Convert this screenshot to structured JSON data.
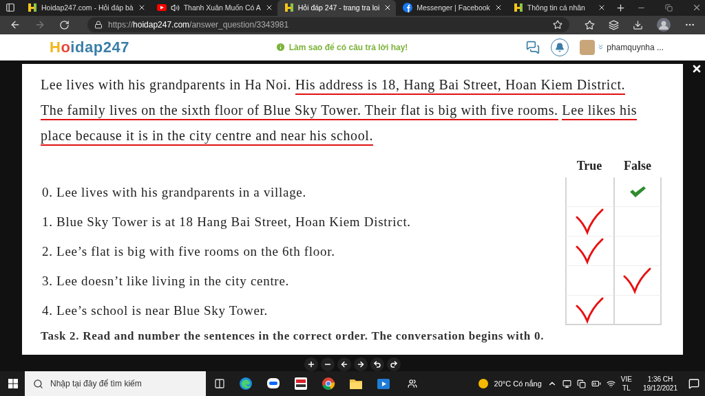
{
  "browser": {
    "tabs": [
      {
        "title": "Hoidap247.com - Hỏi đáp bà",
        "kind": "hoidap",
        "audio": false,
        "selected": false
      },
      {
        "title": "Thanh Xuân Muốn Có A",
        "kind": "video",
        "audio": true,
        "selected": false
      },
      {
        "title": "Hỏi đáp 247 - trang tra loi",
        "kind": "hoidap",
        "audio": false,
        "selected": true
      },
      {
        "title": "Messenger | Facebook",
        "kind": "social",
        "audio": false,
        "selected": false
      },
      {
        "title": "Thông tin cá nhân",
        "kind": "hoidap",
        "audio": false,
        "selected": false
      }
    ],
    "address": {
      "scheme": "https://",
      "domain": "hoidap247.com",
      "path": "/answer_question/3343981"
    }
  },
  "site_header": {
    "logo": "Hoidap247",
    "tip": "Làm sao để có câu trả lời hay!",
    "username": "phamquynha ..."
  },
  "viewer": {
    "document": {
      "paragraph": [
        {
          "text": "Lee lives with his grandparents in Ha Noi.",
          "underlined": false
        },
        {
          "text": "His address is 18, Hang Bai Street, Hoan Kiem District. The family lives on the sixth floor of Blue Sky Tower. Their flat is big with five rooms.",
          "underlined": true
        },
        {
          "text": "Lee likes his place because it is in the city centre and near his school.",
          "underlined": true
        }
      ],
      "columns": [
        "True",
        "False"
      ],
      "statements": [
        {
          "text": "0. Lee lives with his grandparents in a village.",
          "marked_true": false,
          "kind": "example"
        },
        {
          "text": "1. Blue Sky Tower is at 18 Hang Bai Street, Hoan Kiem District.",
          "marked_true": true,
          "kind": "handwritten"
        },
        {
          "text": "2. Lee’s flat is big with five rooms on the 6th floor.",
          "marked_true": true,
          "kind": "handwritten"
        },
        {
          "text": "3. Lee doesn’t like living in the city centre.",
          "marked_true": false,
          "kind": "handwritten"
        },
        {
          "text": "4. Lee’s school is near Blue Sky Tower.",
          "marked_true": true,
          "kind": "handwritten"
        }
      ],
      "task": "Task 2. Read and number the sentences in the correct order. The conversation begins with 0."
    },
    "tools": [
      {
        "kind": "zoom-in"
      },
      {
        "kind": "zoom-out"
      },
      {
        "kind": "previous"
      },
      {
        "kind": "next"
      },
      {
        "kind": "rotate-left"
      },
      {
        "kind": "rotate-right"
      }
    ]
  },
  "taskbar": {
    "search_placeholder": "Nhập tại đây để tìm kiếm",
    "apps": [
      {
        "kind": "task-view"
      },
      {
        "kind": "edge"
      },
      {
        "kind": "chat"
      },
      {
        "kind": "news"
      },
      {
        "kind": "chrome"
      },
      {
        "kind": "folder"
      },
      {
        "kind": "media"
      }
    ],
    "weather": "20°C Có nắng",
    "language": "VIE",
    "layout": "TL",
    "time": "1:36 CH",
    "date": "19/12/2021"
  }
}
